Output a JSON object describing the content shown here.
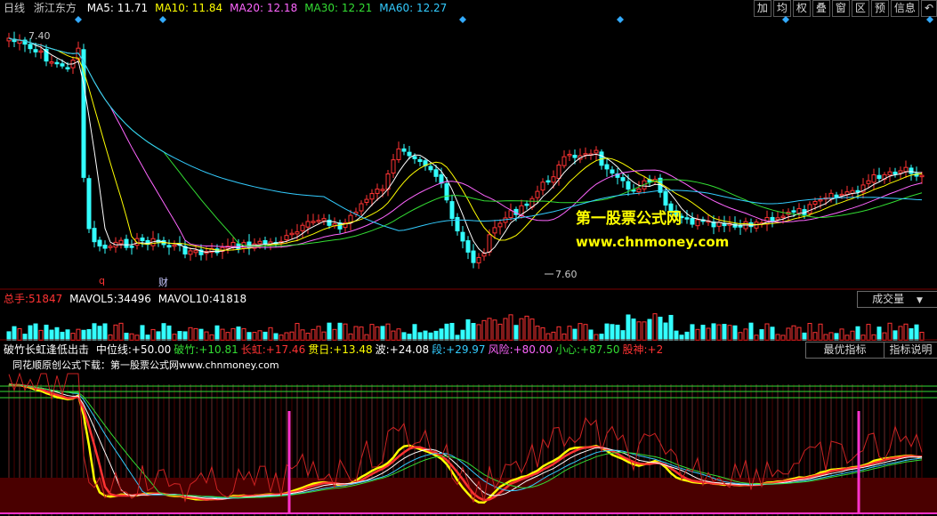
{
  "price_panel": {
    "period": "日线",
    "stock_name": "浙江东方",
    "ma": [
      {
        "label": "MA5:",
        "value": "11.71",
        "color": "#ffffff"
      },
      {
        "label": "MA10:",
        "value": "11.84",
        "color": "#ffff00"
      },
      {
        "label": "MA20:",
        "value": "12.18",
        "color": "#ff66ff"
      },
      {
        "label": "MA30:",
        "value": "12.21",
        "color": "#33dd33"
      },
      {
        "label": "MA60:",
        "value": "12.27",
        "color": "#33ccff"
      }
    ],
    "toolbar": [
      "加",
      "均",
      "权",
      "叠",
      "窗",
      "区",
      "预",
      "信息"
    ],
    "high_label": "7.40",
    "low_label": "7.60",
    "marker_q": "q",
    "marker_cai": "财",
    "watermark_title": "第一股票公式网",
    "watermark_url": "www.chnmoney.com"
  },
  "volume_panel": {
    "label_total": "总手:",
    "total": "51847",
    "label_mavol5": "MAVOL5:",
    "mavol5": "34496",
    "label_mavol10": "MAVOL10:",
    "mavol10": "41818",
    "dropdown": "成交量"
  },
  "indicator_panel": {
    "name": "破竹长虹逢低出击",
    "params": [
      {
        "label": "中位线:",
        "value": "+50.00",
        "color": "#ffffff"
      },
      {
        "label": "破竹:",
        "value": "+10.81",
        "color": "#33dd33"
      },
      {
        "label": "长虹:",
        "value": "+17.46",
        "color": "#ff3333"
      },
      {
        "label": "贯日:",
        "value": "+13.48",
        "color": "#ffff00"
      },
      {
        "label": "波:",
        "value": "+24.08",
        "color": "#ffffff"
      },
      {
        "label": "段:",
        "value": "+29.97",
        "color": "#33ccff"
      },
      {
        "label": "风险:",
        "value": "+80.00",
        "color": "#ff66ff"
      },
      {
        "label": "小心:",
        "value": "+87.50",
        "color": "#33dd33"
      },
      {
        "label": "股神:",
        "value": "+2",
        "color": "#ff3333"
      }
    ],
    "best_button": "最优指标",
    "explain_button": "指标说明",
    "source_text": "同花顺原创公式下载：第一股票公式网www.chnmoney.com"
  }
}
